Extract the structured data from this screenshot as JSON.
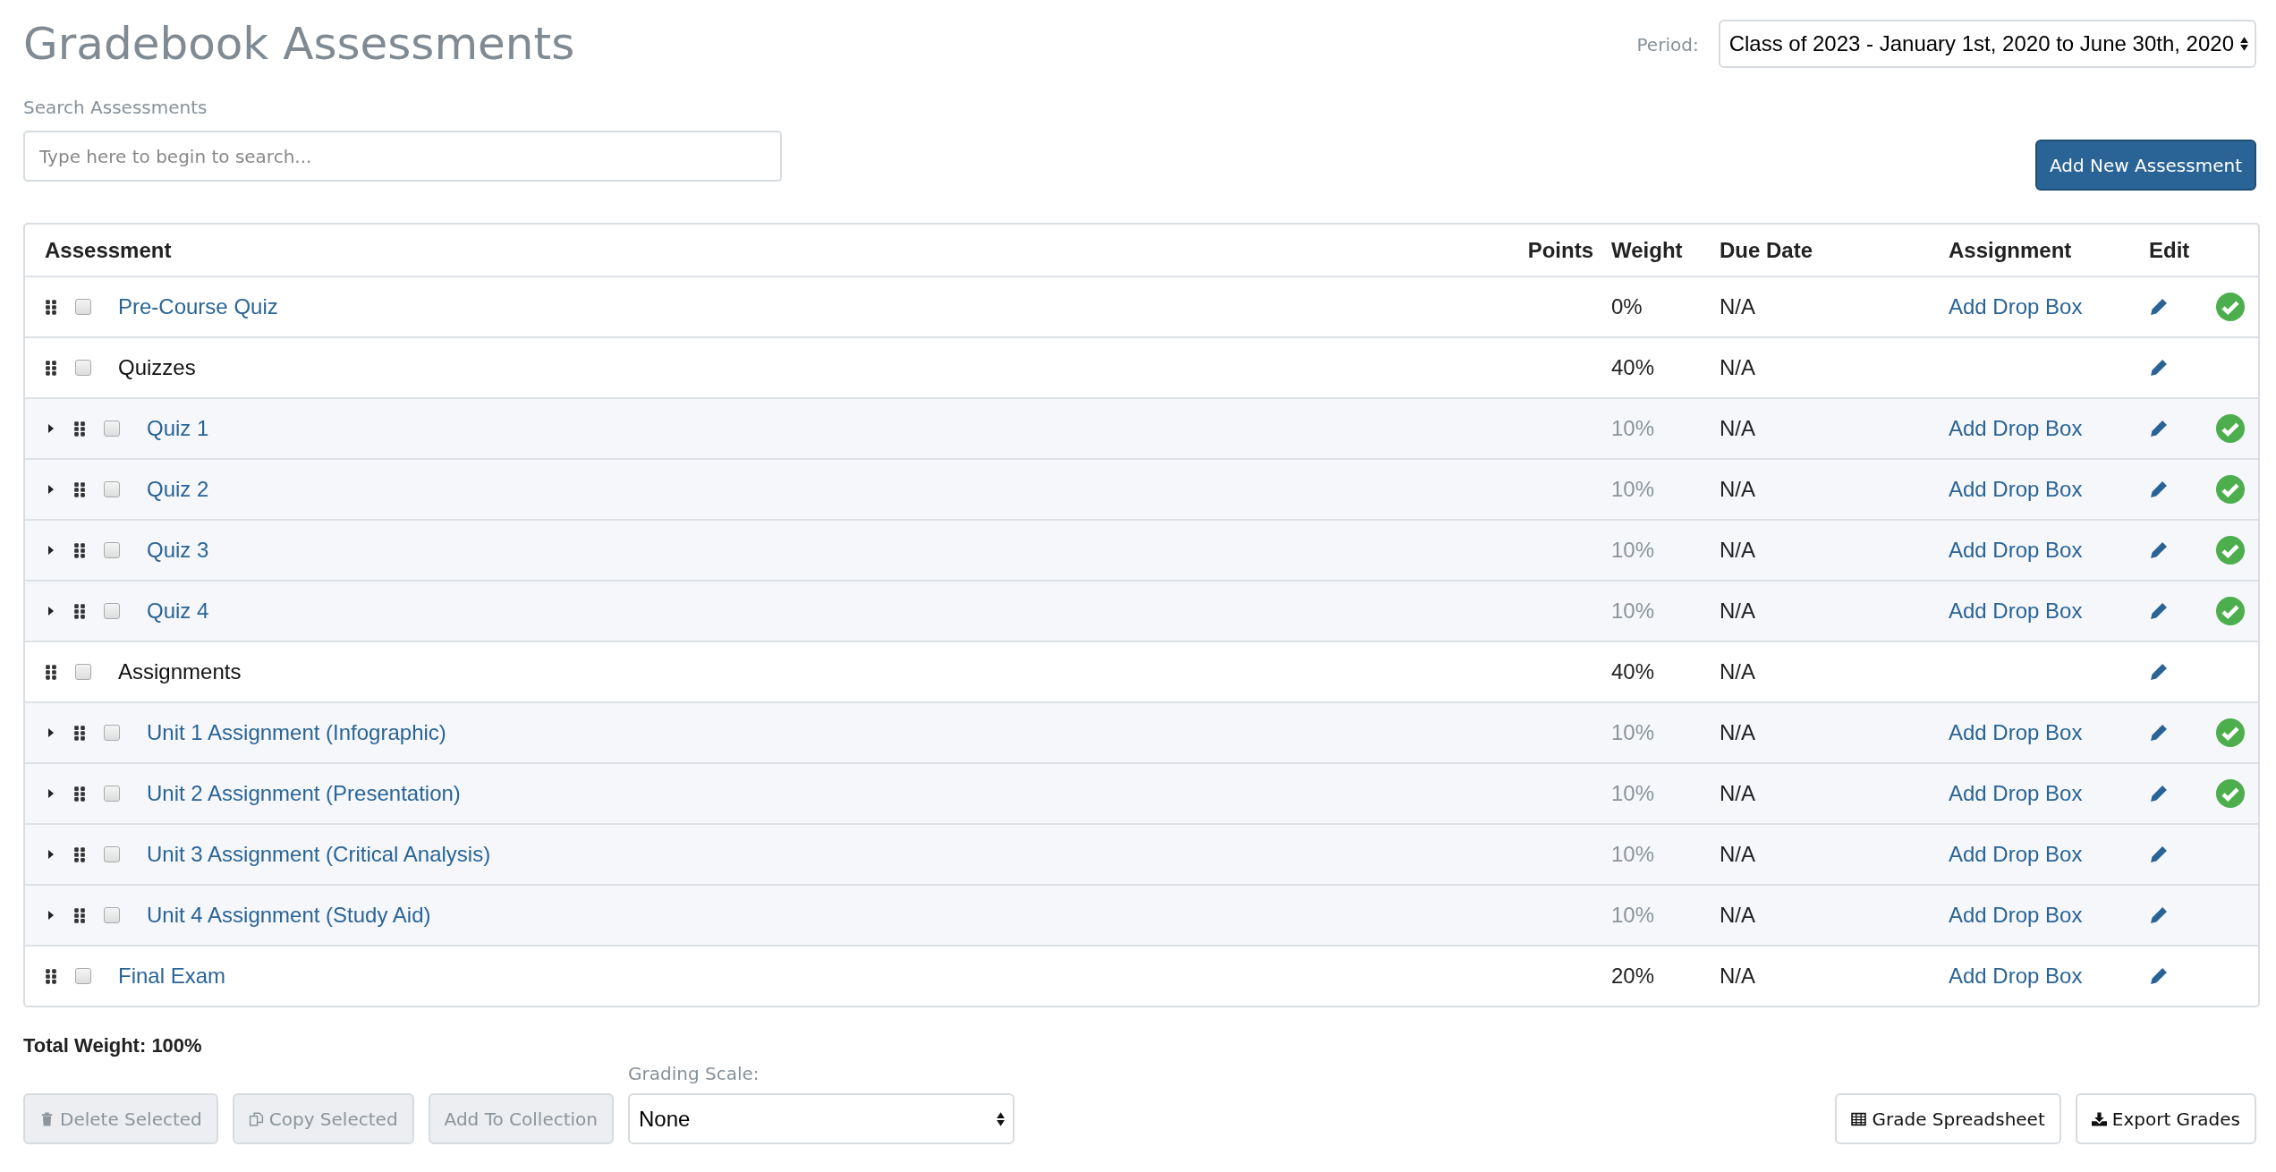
{
  "title": "Gradebook Assessments",
  "period": {
    "label": "Period:",
    "value": "Class of 2023 - January 1st, 2020 to June 30th, 2020"
  },
  "search": {
    "label": "Search Assessments",
    "placeholder": "Type here to begin to search..."
  },
  "add_button": "Add New Assessment",
  "table": {
    "columns": [
      "Assessment",
      "Points",
      "Weight",
      "Due Date",
      "Assignment",
      "Edit"
    ],
    "rows": [
      {
        "name": "Pre-Course Quiz",
        "weight": "0%",
        "due": "N/A",
        "assignment": "Add Drop Box",
        "checked": false,
        "complete": true
      },
      {
        "name": "Quizzes",
        "weight": "40%",
        "due": "N/A",
        "checked": false,
        "complete": false,
        "children": [
          {
            "name": "Quiz 1",
            "weight": "10%",
            "due": "N/A",
            "assignment": "Add Drop Box",
            "checked": false,
            "expanded": false,
            "complete": true
          },
          {
            "name": "Quiz 2",
            "weight": "10%",
            "due": "N/A",
            "assignment": "Add Drop Box",
            "checked": false,
            "expanded": false,
            "complete": true
          },
          {
            "name": "Quiz 3",
            "weight": "10%",
            "due": "N/A",
            "assignment": "Add Drop Box",
            "checked": false,
            "expanded": false,
            "complete": true
          },
          {
            "name": "Quiz 4",
            "weight": "10%",
            "due": "N/A",
            "assignment": "Add Drop Box",
            "checked": false,
            "expanded": false,
            "complete": true
          }
        ]
      },
      {
        "name": "Assignments",
        "weight": "40%",
        "due": "N/A",
        "checked": false,
        "complete": false,
        "children": [
          {
            "name": "Unit 1 Assignment (Infographic)",
            "weight": "10%",
            "due": "N/A",
            "assignment": "Add Drop Box",
            "checked": false,
            "expanded": false,
            "complete": true
          },
          {
            "name": "Unit 2 Assignment (Presentation)",
            "weight": "10%",
            "due": "N/A",
            "assignment": "Add Drop Box",
            "checked": false,
            "expanded": false,
            "complete": true
          },
          {
            "name": "Unit 3 Assignment (Critical Analysis)",
            "weight": "10%",
            "due": "N/A",
            "assignment": "Add Drop Box",
            "checked": false,
            "expanded": false,
            "complete": false
          },
          {
            "name": "Unit 4 Assignment (Study Aid)",
            "weight": "10%",
            "due": "N/A",
            "assignment": "Add Drop Box",
            "checked": false,
            "expanded": false,
            "complete": false
          }
        ]
      },
      {
        "name": "Final Exam",
        "weight": "20%",
        "due": "N/A",
        "assignment": "Add Drop Box",
        "checked": false,
        "complete": false
      }
    ]
  },
  "total_weight": "Total Weight: 100%",
  "actions": [
    {
      "label": "Delete Selected",
      "kind": "trash",
      "disabled": true
    },
    {
      "label": "Copy Selected",
      "kind": "copy",
      "disabled": true
    },
    {
      "label": "Add To Collection",
      "disabled": true
    }
  ],
  "grading_scale": {
    "label": "Grading Scale:",
    "value": "None"
  },
  "tools": [
    {
      "label": "Grade Spreadsheet",
      "kind": "table",
      "disabled": false
    },
    {
      "label": "Export Grades",
      "kind": "download",
      "disabled": false
    }
  ]
}
